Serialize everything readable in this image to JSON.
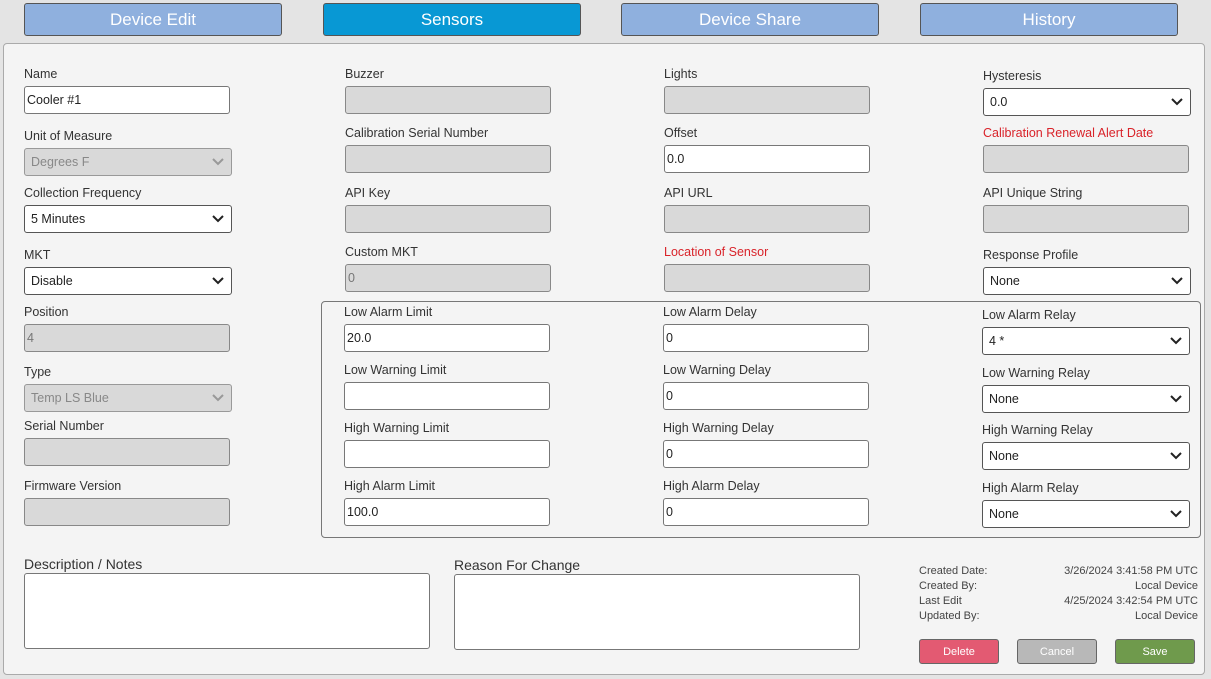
{
  "tabs": [
    "Device Edit",
    "Sensors",
    "Device Share",
    "History"
  ],
  "col1": {
    "name_label": "Name",
    "name_value": "Cooler #1",
    "uom_label": "Unit of Measure",
    "uom_value": "Degrees F",
    "freq_label": "Collection Frequency",
    "freq_value": "5 Minutes",
    "mkt_label": "MKT",
    "mkt_value": "Disable",
    "position_label": "Position",
    "position_value": "4",
    "type_label": "Type",
    "type_value": "Temp LS Blue",
    "serial_label": "Serial Number",
    "serial_value": "",
    "firmware_label": "Firmware Version",
    "firmware_value": ""
  },
  "col2": {
    "buzzer_label": "Buzzer",
    "buzzer_value": "",
    "cal_serial_label": "Calibration Serial Number",
    "cal_serial_value": "",
    "api_key_label": "API Key",
    "api_key_value": "",
    "custom_mkt_label": "Custom MKT",
    "custom_mkt_value": "0"
  },
  "col3": {
    "lights_label": "Lights",
    "lights_value": "",
    "offset_label": "Offset",
    "offset_value": "0.0",
    "api_url_label": "API URL",
    "api_url_value": "",
    "location_label": "Location of Sensor",
    "location_value": ""
  },
  "col4": {
    "hysteresis_label": "Hysteresis",
    "hysteresis_value": "0.0",
    "cal_renewal_label": "Calibration Renewal Alert Date",
    "cal_renewal_value": "",
    "api_unique_label": "API Unique String",
    "api_unique_value": "",
    "response_label": "Response Profile",
    "response_value": "None"
  },
  "alarms": {
    "low_alarm_limit_label": "Low Alarm Limit",
    "low_alarm_limit_value": "20.0",
    "low_warning_limit_label": "Low Warning Limit",
    "low_warning_limit_value": "",
    "high_warning_limit_label": "High Warning Limit",
    "high_warning_limit_value": "",
    "high_alarm_limit_label": "High Alarm Limit",
    "high_alarm_limit_value": "100.0",
    "low_alarm_delay_label": "Low Alarm Delay",
    "low_alarm_delay_value": "0",
    "low_warning_delay_label": "Low Warning Delay",
    "low_warning_delay_value": "0",
    "high_warning_delay_label": "High Warning Delay",
    "high_warning_delay_value": "0",
    "high_alarm_delay_label": "High Alarm Delay",
    "high_alarm_delay_value": "0",
    "low_alarm_relay_label": "Low Alarm Relay",
    "low_alarm_relay_value": "4 *",
    "low_warning_relay_label": "Low Warning Relay",
    "low_warning_relay_value": "None",
    "high_warning_relay_label": "High Warning Relay",
    "high_warning_relay_value": "None",
    "high_alarm_relay_label": "High Alarm Relay",
    "high_alarm_relay_value": "None"
  },
  "notes": {
    "description_label": "Description / Notes",
    "reason_label": "Reason For Change"
  },
  "meta": {
    "created_date_label": "Created Date:",
    "created_date_value": "3/26/2024 3:41:58 PM UTC",
    "created_by_label": "Created By:",
    "created_by_value": "Local Device",
    "last_edit_label": "Last Edit",
    "last_edit_value": "4/25/2024 3:42:54 PM UTC",
    "updated_by_label": "Updated By:",
    "updated_by_value": "Local Device"
  },
  "buttons": {
    "delete": "Delete",
    "cancel": "Cancel",
    "save": "Save"
  },
  "colors": {
    "tab": "#8fb0de",
    "tab_active": "#0898d4",
    "delete": "#e35a72",
    "cancel": "#b8b8b8",
    "save": "#6f9a4c",
    "required_label": "#d9232a"
  },
  "icons": {
    "select_arrow": "chevron-down-icon"
  }
}
